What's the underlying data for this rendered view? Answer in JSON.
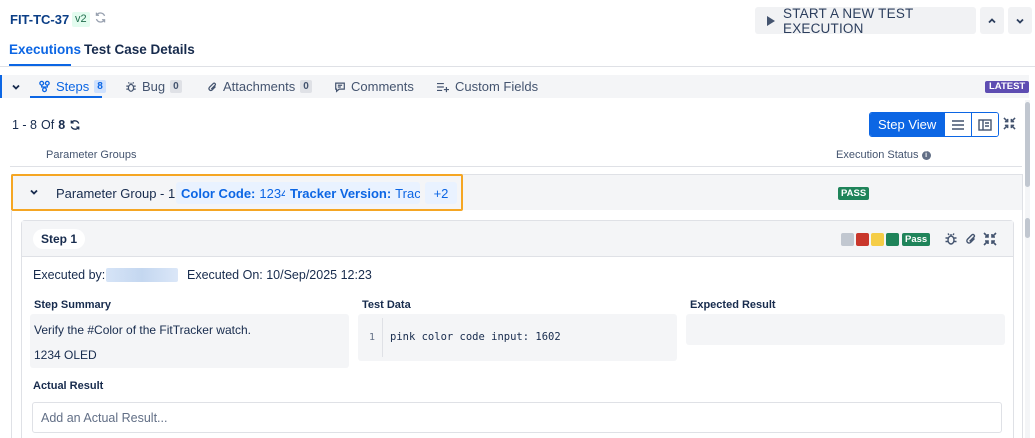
{
  "header": {
    "issue_key": "FIT-TC-37",
    "version": "v2",
    "start_button": "START A NEW TEST EXECUTION"
  },
  "tabs": {
    "executions": "Executions",
    "details": "Test Case Details"
  },
  "subtabs": {
    "steps": {
      "label": "Steps",
      "count": "8"
    },
    "bug": {
      "label": "Bug",
      "count": "0"
    },
    "attachments": {
      "label": "Attachments",
      "count": "0"
    },
    "comments": {
      "label": "Comments"
    },
    "custom_fields": {
      "label": "Custom Fields"
    },
    "latest_badge": "LATEST"
  },
  "pager": {
    "range": "1 - 8",
    "of": "Of",
    "total": "8"
  },
  "toolbar": {
    "step_view": "Step View"
  },
  "columns": {
    "left": "Parameter Groups",
    "right": "Execution Status"
  },
  "group": {
    "label": "Parameter Group - 1",
    "chips": [
      {
        "key": "Color Code:",
        "value": "1234"
      },
      {
        "key": "Tracker Version:",
        "value": "Trac..."
      }
    ],
    "more": "+2",
    "status": "PASS"
  },
  "step": {
    "title": "Step 1",
    "status": "Pass",
    "executed_by_label": "Executed by:",
    "executed_on": "Executed On: 10/Sep/2025 12:23",
    "summary_label": "Step Summary",
    "summary_lines": [
      "Verify the #Color of the FitTracker watch.",
      "1234 OLED"
    ],
    "test_data_label": "Test Data",
    "code_line_no": "1",
    "code_line": "pink color code input: 1602",
    "expected_label": "Expected Result",
    "actual_label": "Actual Result",
    "actual_placeholder": "Add an Actual Result..."
  },
  "colors": {
    "accent": "#0c66e4",
    "pass": "#1f845a",
    "highlight": "#f5a623",
    "latest": "#5e4db2"
  }
}
